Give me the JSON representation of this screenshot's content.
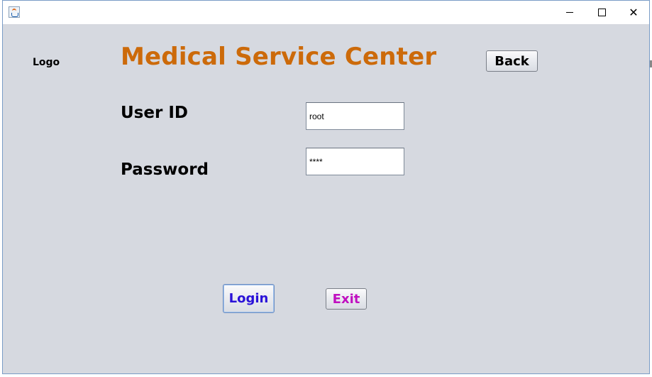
{
  "window": {
    "title": "",
    "controls": {
      "minimize": "minimize-icon",
      "maximize": "maximize-icon",
      "close": "close-icon",
      "close_glyph": "✕"
    }
  },
  "header": {
    "logo_label": "Logo",
    "title": "Medical Service Center",
    "back_label": "Back"
  },
  "form": {
    "user_id": {
      "label": "User ID",
      "value": "root"
    },
    "password": {
      "label": "Password",
      "value": "****"
    }
  },
  "actions": {
    "login_label": "Login",
    "exit_label": "Exit"
  },
  "colors": {
    "title": "#cc6a0a",
    "login_text": "#2a12d8",
    "exit_text": "#c010c0",
    "background": "#d6d9e0"
  }
}
